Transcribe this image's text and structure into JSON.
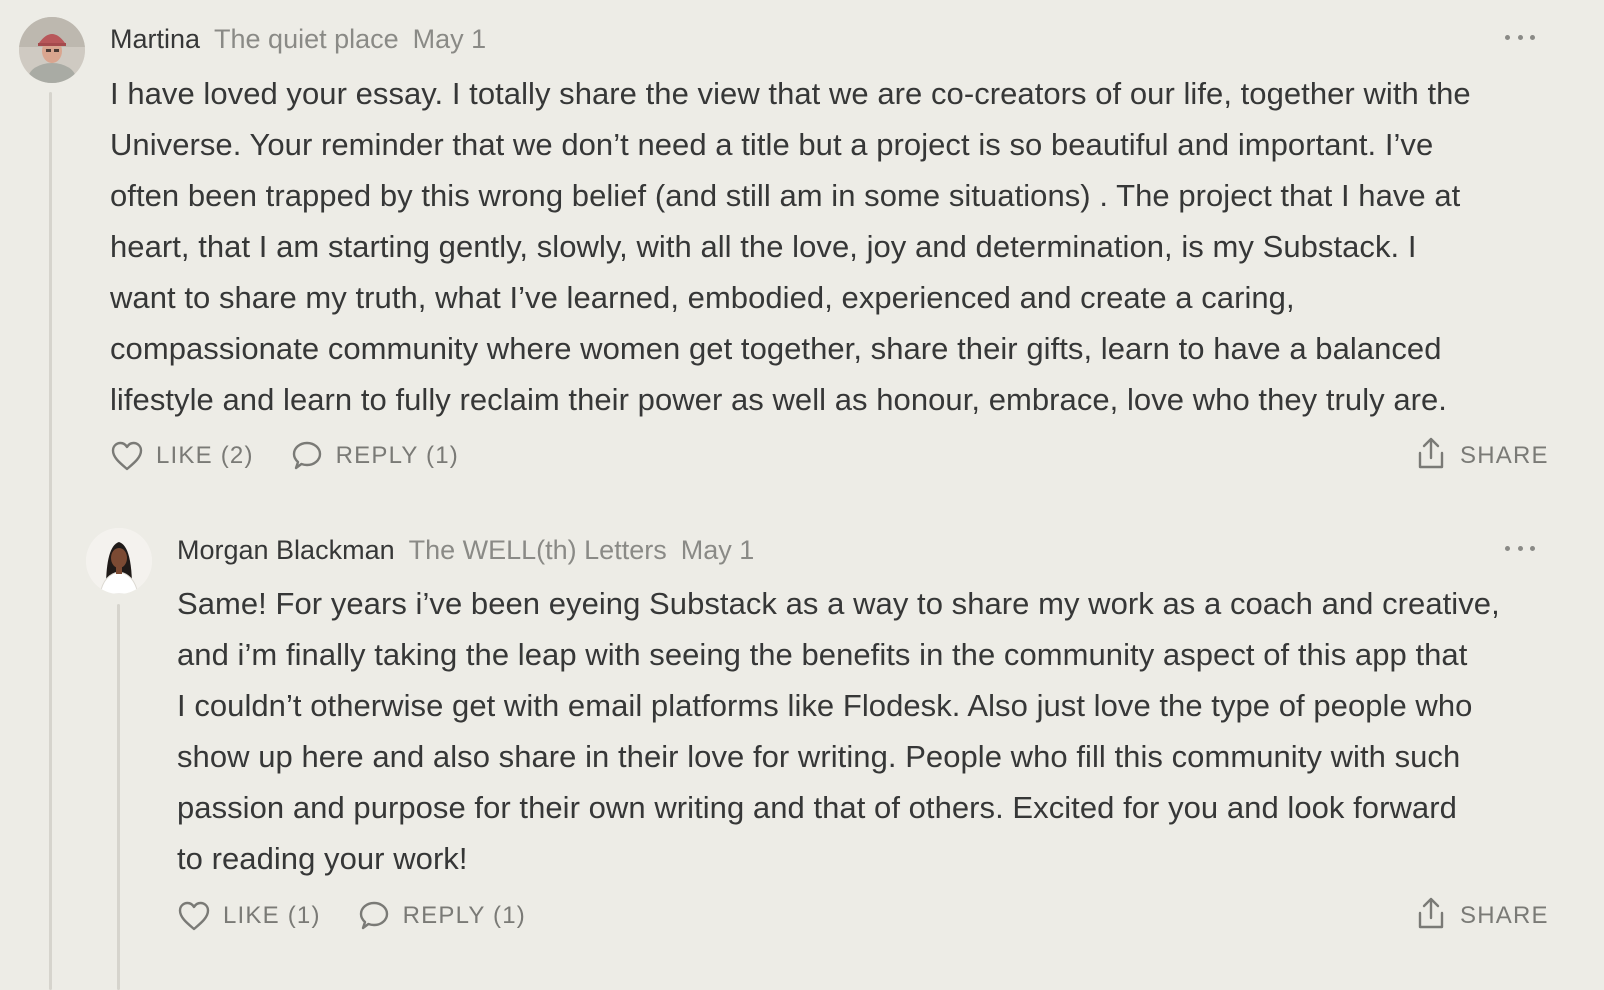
{
  "comments": [
    {
      "author": "Martina",
      "publication": "The quiet place",
      "date": "May 1",
      "body_lines": [
        "I have loved your essay. I totally share the view that we are co-creators of our life, together with the",
        "Universe. Your reminder that we don’t need a title but a project is so beautiful and important. I’ve",
        "often been trapped by this wrong belief (and still am in some situations) . The project that I have at",
        "heart, that I am starting gently, slowly, with all the love, joy and determination, is my Substack. I",
        "want to share my truth, what I’ve learned, embodied, experienced and create a caring,",
        "compassionate community where women get together, share their gifts, learn to have a balanced",
        "lifestyle and learn to fully reclaim their power as well as honour, embrace, love who they truly are."
      ],
      "like_label": "LIKE (2)",
      "reply_label": "REPLY (1)",
      "share_label": "SHARE",
      "avatar_icon": "avatar-photo"
    },
    {
      "author": "Morgan Blackman",
      "publication": "The WELL(th) Letters",
      "date": "May 1",
      "body_lines": [
        "Same! For years i’ve been eyeing Substack as a way to share my work as a coach and creative,",
        "and i’m finally taking the leap with seeing the benefits in the community aspect of this app that",
        "I couldn’t otherwise get with email platforms like Flodesk. Also just love the type of people who",
        "show up here and also share in their love for writing. People who fill this community with such",
        "passion and purpose for their own writing and that of others. Excited for you and look forward",
        "to reading your work!"
      ],
      "like_label": "LIKE (1)",
      "reply_label": "REPLY (1)",
      "share_label": "SHARE",
      "avatar_icon": "avatar-photo"
    }
  ],
  "icons": {
    "like": "heart-icon",
    "reply": "speech-bubble-icon",
    "share": "share-upload-icon",
    "more": "ellipsis-icon"
  },
  "colors": {
    "background": "#edece6",
    "text": "#363737",
    "muted": "#8a8a86",
    "thread_line": "#d6d4cd"
  }
}
